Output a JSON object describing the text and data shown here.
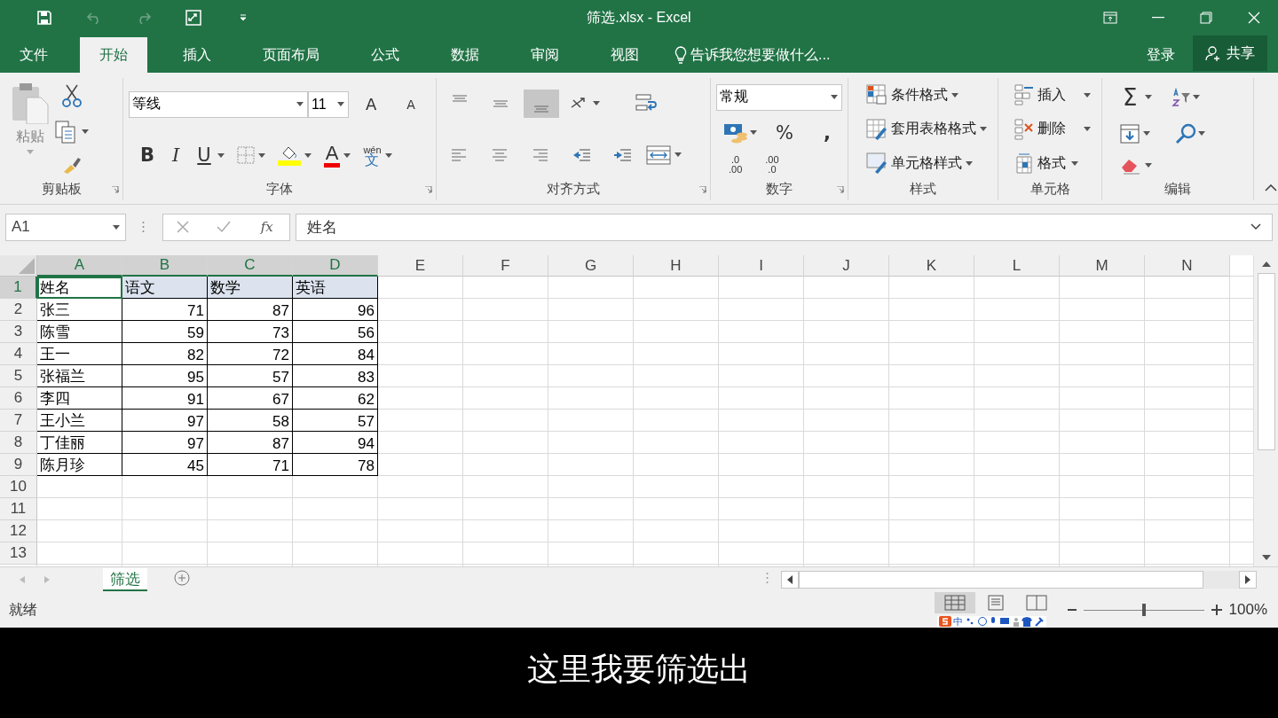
{
  "window": {
    "title": "筛选.xlsx - Excel"
  },
  "tabs": [
    {
      "label": "文件",
      "selected": false
    },
    {
      "label": "开始",
      "selected": true
    },
    {
      "label": "插入",
      "selected": false
    },
    {
      "label": "页面布局",
      "selected": false
    },
    {
      "label": "公式",
      "selected": false
    },
    {
      "label": "数据",
      "selected": false
    },
    {
      "label": "审阅",
      "selected": false
    },
    {
      "label": "视图",
      "selected": false
    }
  ],
  "tell_me": "告诉我您想要做什么...",
  "sign_in": "登录",
  "share": "共享",
  "ribbon": {
    "clipboard": {
      "paste": "粘贴",
      "label": "剪贴板"
    },
    "font": {
      "name": "等线",
      "size": "11",
      "grow": "A",
      "shrink": "A",
      "bold": "B",
      "italic": "I",
      "underline": "U",
      "font_color": "A",
      "phonetic": "wén",
      "phonetic_char": "文",
      "label": "字体"
    },
    "alignment": {
      "vertical": [
        {
          "selected": false
        },
        {
          "selected": false
        },
        {
          "selected": true
        }
      ],
      "label": "对齐方式"
    },
    "number": {
      "format": "常规",
      "percent": "%",
      "comma": ",",
      "increase_decimal": [
        ".0",
        ".00"
      ],
      "decrease_decimal": [
        ".00",
        ".0"
      ],
      "label": "数字"
    },
    "styles": {
      "buttons": [
        "条件格式",
        "套用表格格式",
        "单元格样式"
      ],
      "label": "样式"
    },
    "cells": {
      "buttons": [
        "插入",
        "删除",
        "格式"
      ],
      "label": "单元格"
    },
    "editing": {
      "sum": "Σ",
      "label": "编辑"
    }
  },
  "name_box": "A1",
  "fx": "fx",
  "formula": "姓名",
  "columns": [
    {
      "letter": "A",
      "selected": true
    },
    {
      "letter": "B",
      "selected": true
    },
    {
      "letter": "C",
      "selected": true
    },
    {
      "letter": "D",
      "selected": true
    },
    {
      "letter": "E",
      "selected": false
    },
    {
      "letter": "F",
      "selected": false
    },
    {
      "letter": "G",
      "selected": false
    },
    {
      "letter": "H",
      "selected": false
    },
    {
      "letter": "I",
      "selected": false
    },
    {
      "letter": "J",
      "selected": false
    },
    {
      "letter": "K",
      "selected": false
    },
    {
      "letter": "L",
      "selected": false
    },
    {
      "letter": "M",
      "selected": false
    },
    {
      "letter": "N",
      "selected": false
    }
  ],
  "rows": [
    {
      "number": "1",
      "selected": true,
      "cells": [
        {
          "text": "姓名",
          "kind": "text"
        },
        {
          "text": "语文",
          "kind": "text"
        },
        {
          "text": "数学",
          "kind": "text"
        },
        {
          "text": "英语",
          "kind": "text"
        }
      ]
    },
    {
      "number": "2",
      "selected": false,
      "cells": [
        {
          "text": "张三",
          "kind": "text"
        },
        {
          "text": "71",
          "kind": "number"
        },
        {
          "text": "87",
          "kind": "number"
        },
        {
          "text": "96",
          "kind": "number"
        }
      ]
    },
    {
      "number": "3",
      "selected": false,
      "cells": [
        {
          "text": "陈雪",
          "kind": "text"
        },
        {
          "text": "59",
          "kind": "number"
        },
        {
          "text": "73",
          "kind": "number"
        },
        {
          "text": "56",
          "kind": "number"
        }
      ]
    },
    {
      "number": "4",
      "selected": false,
      "cells": [
        {
          "text": "王一",
          "kind": "text"
        },
        {
          "text": "82",
          "kind": "number"
        },
        {
          "text": "72",
          "kind": "number"
        },
        {
          "text": "84",
          "kind": "number"
        }
      ]
    },
    {
      "number": "5",
      "selected": false,
      "cells": [
        {
          "text": "张福兰",
          "kind": "text"
        },
        {
          "text": "95",
          "kind": "number"
        },
        {
          "text": "57",
          "kind": "number"
        },
        {
          "text": "83",
          "kind": "number"
        }
      ]
    },
    {
      "number": "6",
      "selected": false,
      "cells": [
        {
          "text": "李四",
          "kind": "text"
        },
        {
          "text": "91",
          "kind": "number"
        },
        {
          "text": "67",
          "kind": "number"
        },
        {
          "text": "62",
          "kind": "number"
        }
      ]
    },
    {
      "number": "7",
      "selected": false,
      "cells": [
        {
          "text": "王小兰",
          "kind": "text"
        },
        {
          "text": "97",
          "kind": "number"
        },
        {
          "text": "58",
          "kind": "number"
        },
        {
          "text": "57",
          "kind": "number"
        }
      ]
    },
    {
      "number": "8",
      "selected": false,
      "cells": [
        {
          "text": "丁佳丽",
          "kind": "text"
        },
        {
          "text": "97",
          "kind": "number"
        },
        {
          "text": "87",
          "kind": "number"
        },
        {
          "text": "94",
          "kind": "number"
        }
      ]
    },
    {
      "number": "9",
      "selected": false,
      "cells": [
        {
          "text": "陈月珍",
          "kind": "text"
        },
        {
          "text": "45",
          "kind": "number"
        },
        {
          "text": "71",
          "kind": "number"
        },
        {
          "text": "78",
          "kind": "number"
        }
      ]
    },
    {
      "number": "10",
      "selected": false,
      "cells": []
    },
    {
      "number": "11",
      "selected": false,
      "cells": []
    },
    {
      "number": "12",
      "selected": false,
      "cells": []
    },
    {
      "number": "13",
      "selected": false,
      "cells": []
    }
  ],
  "sheet_tabs": [
    {
      "label": "筛选",
      "selected": true
    }
  ],
  "status_bar": {
    "status": "就绪",
    "views": [
      {
        "selected": true
      },
      {
        "selected": false
      },
      {
        "selected": false
      }
    ],
    "zoom_slider": {
      "level": 0.5
    },
    "zoom": "100%",
    "ime": "中"
  },
  "subtitle": "这里我要筛选出"
}
